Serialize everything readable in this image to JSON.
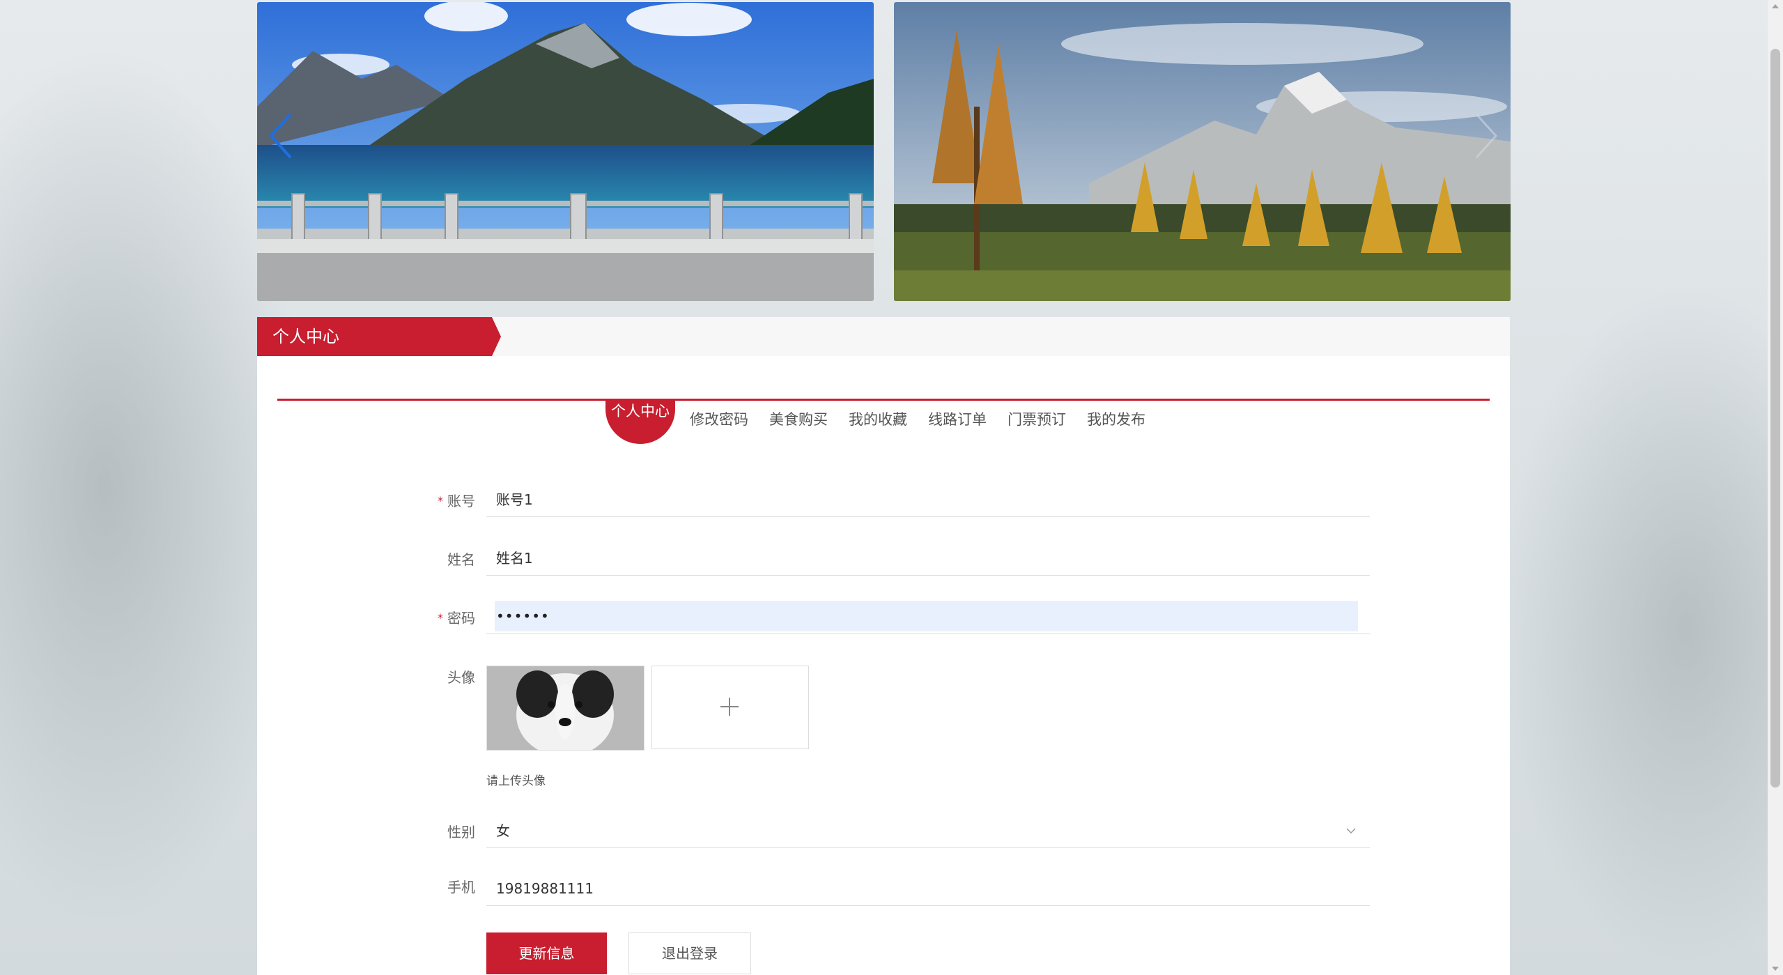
{
  "carousel": {
    "slides": [
      {
        "alt_icon": "lake-mountain-image"
      },
      {
        "alt_icon": "autumn-forest-mountain-image"
      }
    ]
  },
  "panel": {
    "title": "个人中心"
  },
  "tabs": [
    {
      "label": "个人中心",
      "active": true
    },
    {
      "label": "修改密码",
      "active": false
    },
    {
      "label": "美食购买",
      "active": false
    },
    {
      "label": "我的收藏",
      "active": false
    },
    {
      "label": "线路订单",
      "active": false
    },
    {
      "label": "门票预订",
      "active": false
    },
    {
      "label": "我的发布",
      "active": false
    }
  ],
  "form": {
    "account": {
      "label": "账号",
      "required_mark": "*",
      "value": "账号1"
    },
    "name": {
      "label": "姓名",
      "value": "姓名1"
    },
    "password": {
      "label": "密码",
      "required_mark": "*",
      "value": "••••••"
    },
    "avatar": {
      "label": "头像",
      "hint": "请上传头像"
    },
    "gender": {
      "label": "性别",
      "value": "女"
    },
    "phone": {
      "label": "手机",
      "value": "19819881111"
    }
  },
  "buttons": {
    "update": "更新信息",
    "logout": "退出登录"
  },
  "colors": {
    "accent": "#c81e2f",
    "autofill": "#e8f0fe"
  }
}
